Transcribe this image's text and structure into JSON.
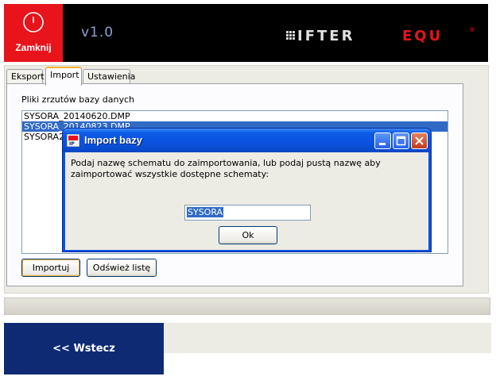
{
  "header": {
    "close_label": "Zamknij",
    "version": "v1.0",
    "brand_left": "IFTER",
    "brand_right": "EQU",
    "registered": "®"
  },
  "tabs": [
    {
      "label": "Eksport",
      "active": false
    },
    {
      "label": "Import",
      "active": true
    },
    {
      "label": "Ustawienia",
      "active": false
    }
  ],
  "import_page": {
    "dumps_label": "Pliki zrzutów bazy danych",
    "dump_files": [
      "SYSORA_20140620.DMP",
      "SYSORA_20140823.DMP",
      "SYSORA2"
    ],
    "selected_index": 1,
    "import_button": "Importuj",
    "refresh_button": "Odśwież listę"
  },
  "back_button": "<< Wstecz",
  "dialog": {
    "title": "Import bazy",
    "message": "Podaj nazwę schematu do zaimportowania, lub podaj pustą nazwę aby zaimportować wszystkie dostępne schematy:",
    "input_value": "SYSORA",
    "ok_button": "Ok"
  },
  "colors": {
    "close_tile": "#e8131b",
    "header_bg": "#000000",
    "back_bg": "#0e2a73",
    "selection": "#316ac5",
    "titlebar": "#0a52df"
  }
}
